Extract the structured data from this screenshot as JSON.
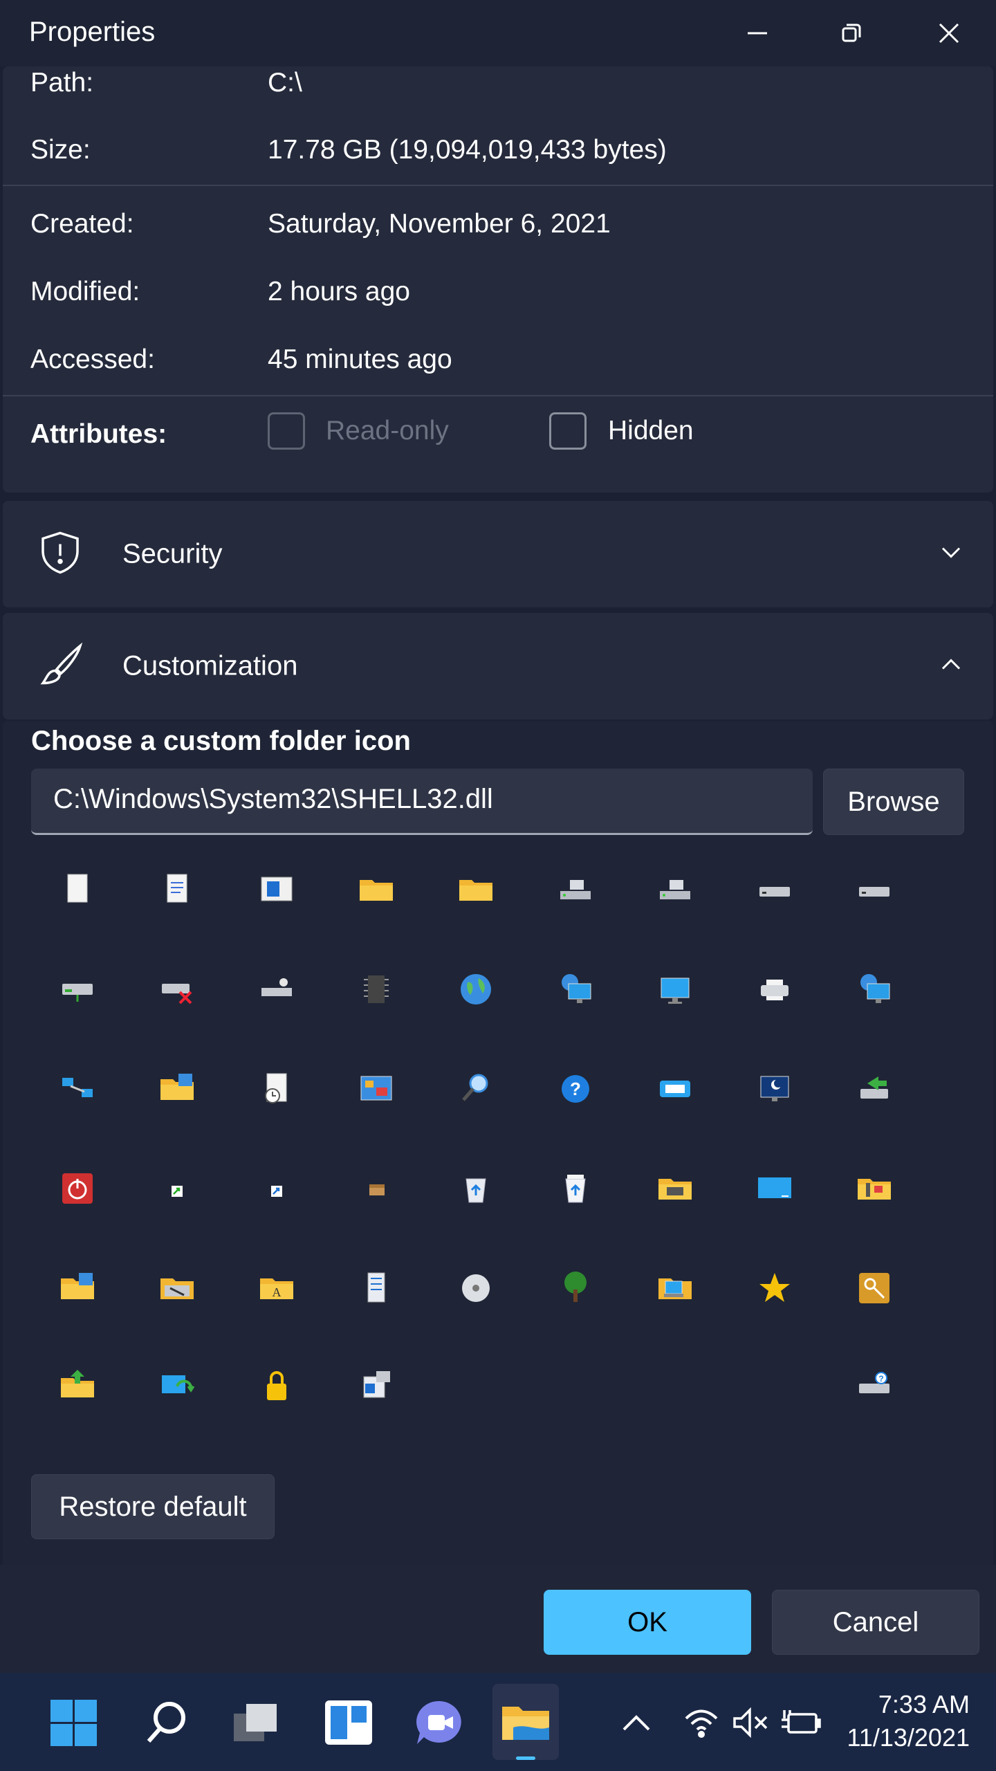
{
  "window": {
    "title": "Properties"
  },
  "general": {
    "path_label": "Path:",
    "path_value": "C:\\",
    "size_label": "Size:",
    "size_value": "17.78 GB (19,094,019,433 bytes)",
    "created_label": "Created:",
    "created_value": "Saturday, November 6, 2021",
    "modified_label": "Modified:",
    "modified_value": "2 hours ago",
    "accessed_label": "Accessed:",
    "accessed_value": "45 minutes ago",
    "attributes_label": "Attributes:",
    "readonly_label": "Read-only",
    "hidden_label": "Hidden"
  },
  "security": {
    "label": "Security"
  },
  "customization": {
    "label": "Customization",
    "heading": "Choose a custom folder icon",
    "path_value": "C:\\Windows\\System32\\SHELL32.dll",
    "browse_label": "Browse",
    "restore_label": "Restore default",
    "icons": [
      "blank-document-icon",
      "text-document-icon",
      "application-window-icon",
      "folder-icon",
      "folder-icon",
      "drive-icon",
      "removable-drive-icon",
      "hard-drive-icon",
      "hard-drive-icon",
      "network-drive-icon",
      "disconnected-drive-icon",
      "cd-drive-icon",
      "memory-chip-icon",
      "globe-icon",
      "network-computer-icon",
      "monitor-icon",
      "printer-icon",
      "network-globe-icon",
      "network-icon",
      "folder-grid-icon",
      "clock-document-icon",
      "control-panel-icon",
      "search-icon",
      "help-icon",
      "run-icon",
      "sleep-monitor-icon",
      "network-transfer-icon",
      "power-icon",
      "shortcut-arrow-icon",
      "shortcut-overlay-icon",
      "package-icon",
      "recycle-bin-empty-icon",
      "recycle-bin-full-icon",
      "shared-folder-icon",
      "desktop-icon",
      "tools-folder-icon",
      "folder-grid-icon",
      "drive-backup-icon",
      "fonts-folder-icon",
      "server-icon",
      "optical-disc-icon",
      "tree-icon",
      "computer-folder-icon",
      "star-icon",
      "key-icon",
      "folder-upload-icon",
      "sync-icon",
      "lock-icon",
      "device-settings-icon",
      "",
      "",
      "",
      "",
      "network-drive-help-icon"
    ]
  },
  "footer": {
    "ok_label": "OK",
    "cancel_label": "Cancel"
  },
  "taskbar": {
    "time": "7:33 AM",
    "date": "11/13/2021"
  },
  "colors": {
    "accent": "#4cc2ff",
    "background": "#1b2132",
    "card": "#252b3c"
  }
}
